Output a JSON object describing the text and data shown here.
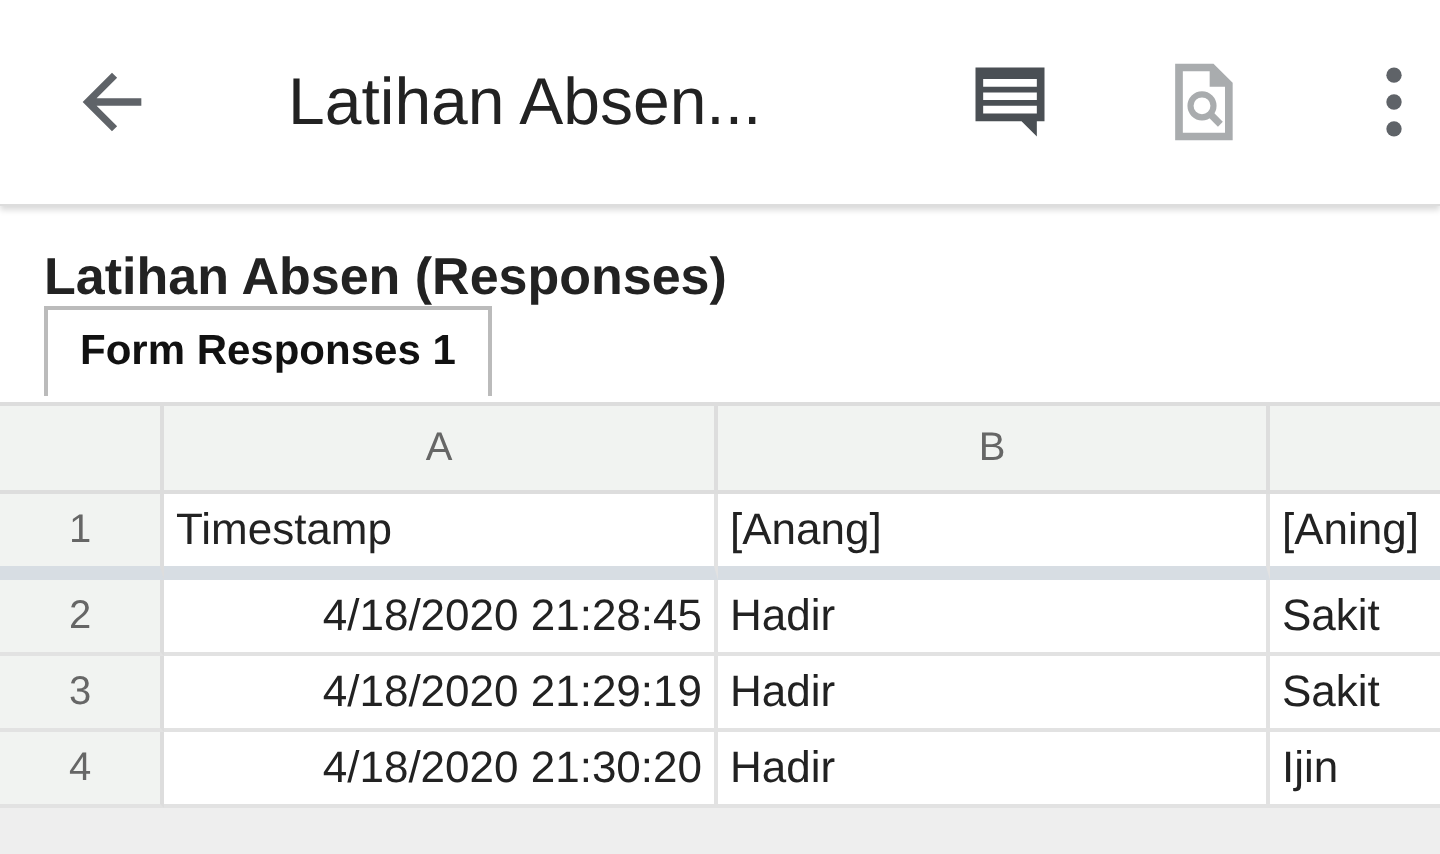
{
  "app_bar": {
    "title": "Latihan Absen...",
    "actions": [
      {
        "kind": "comments",
        "disabled": false
      },
      {
        "kind": "find",
        "disabled": true
      },
      {
        "kind": "more",
        "disabled": false
      }
    ]
  },
  "sheet_title": "Latihan Absen (Responses)",
  "tabs": [
    {
      "label": "Form Responses 1",
      "selected": true
    }
  ],
  "grid": {
    "column_headers": [
      "A",
      "B"
    ],
    "rows": [
      {
        "number": "1",
        "frozen": true,
        "cells": [
          {
            "text": "Timestamp",
            "right_aligned": false
          },
          {
            "text": "[Anang]",
            "right_aligned": false
          },
          {
            "text": "[Aning]",
            "right_aligned": false
          }
        ]
      },
      {
        "number": "2",
        "frozen": false,
        "cells": [
          {
            "text": "4/18/2020 21:28:45",
            "right_aligned": true
          },
          {
            "text": "Hadir",
            "right_aligned": false
          },
          {
            "text": "Sakit",
            "right_aligned": false
          }
        ]
      },
      {
        "number": "3",
        "frozen": false,
        "cells": [
          {
            "text": "4/18/2020 21:29:19",
            "right_aligned": true
          },
          {
            "text": "Hadir",
            "right_aligned": false
          },
          {
            "text": "Sakit",
            "right_aligned": false
          }
        ]
      },
      {
        "number": "4",
        "frozen": false,
        "cells": [
          {
            "text": "4/18/2020 21:30:20",
            "right_aligned": true
          },
          {
            "text": "Hadir",
            "right_aligned": false
          },
          {
            "text": "Ijin",
            "right_aligned": false
          }
        ]
      }
    ]
  }
}
